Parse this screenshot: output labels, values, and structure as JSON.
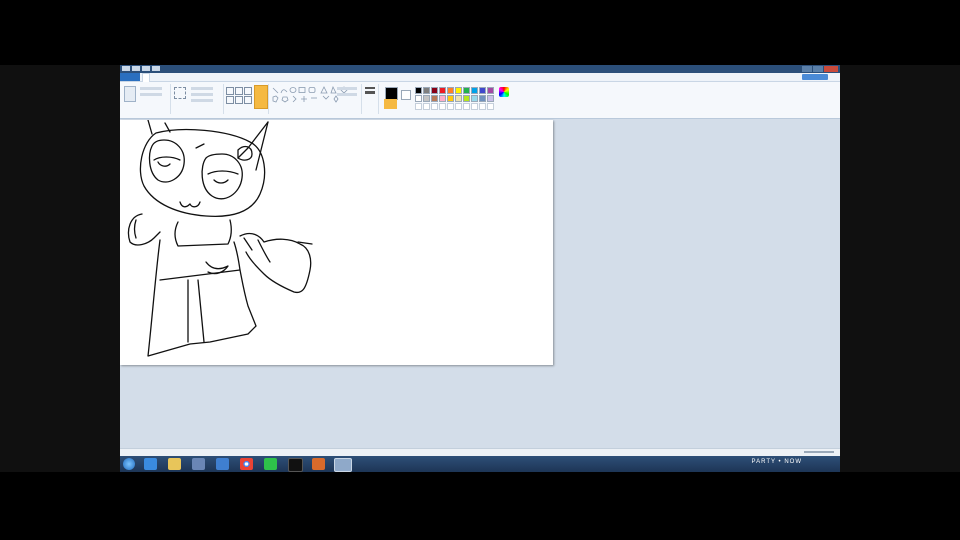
{
  "window": {
    "title": "",
    "help_label": ""
  },
  "ribbon": {
    "tab_file": "",
    "tab_home": "",
    "tab_view": "",
    "colors": [
      "#000000",
      "#7f7f7f",
      "#880015",
      "#ed1c24",
      "#ff7f27",
      "#fff200",
      "#22b14c",
      "#00a2e8",
      "#3f48cc",
      "#a349a4",
      "#ffffff",
      "#c3c3c3",
      "#b97a57",
      "#ffaec9",
      "#ffc90e",
      "#efe4b0",
      "#b5e61d",
      "#99d9ea",
      "#7092be",
      "#c8bfe7"
    ],
    "color1": "#000000",
    "color2": "#ffffff",
    "active_tool_color": "#f5b942"
  },
  "canvas": {
    "drawing": "cat-character-sketch"
  },
  "status": {
    "pos": "",
    "size": "",
    "zoom": ""
  },
  "taskbar": {
    "tray_text": "PARTY • NOW",
    "clock": "",
    "apps": [
      "ie",
      "explorer",
      "media",
      "paint-folder",
      "chrome",
      "line",
      "video",
      "office",
      "paint"
    ]
  }
}
